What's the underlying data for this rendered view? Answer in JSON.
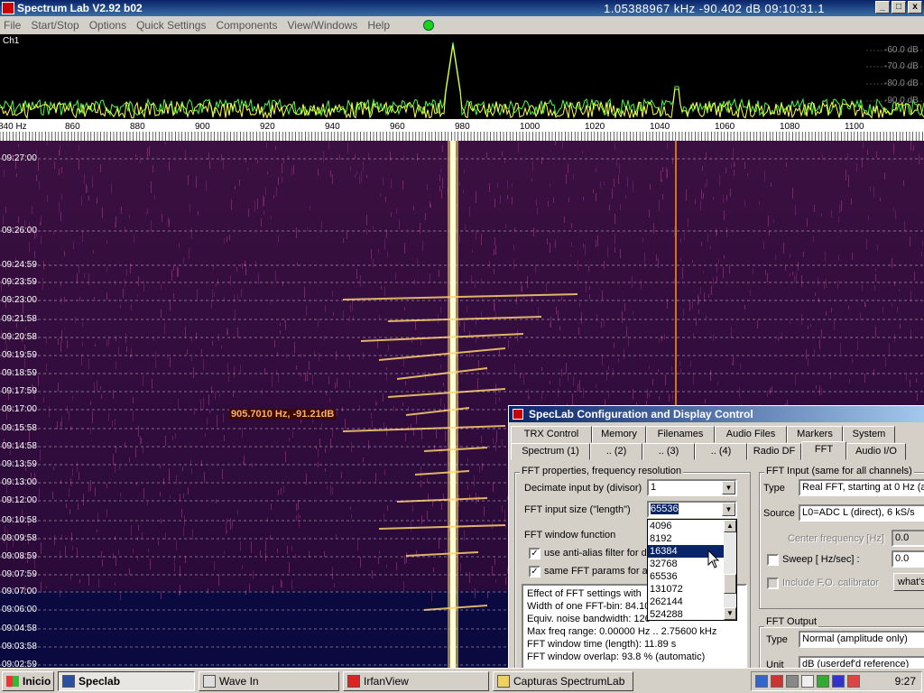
{
  "window": {
    "title": "Spectrum Lab V2.92 b02",
    "readout": "1.05388967 kHz  -90.402 dB  09:10:31.1",
    "min_glyph": "_",
    "max_glyph": "□",
    "close_glyph": "x"
  },
  "menu": [
    "File",
    "Start/Stop",
    "Options",
    "Quick Settings",
    "Components",
    "View/Windows",
    "Help"
  ],
  "spectrum": {
    "channel": "Ch1",
    "db_labels": [
      "-60.0 dB",
      "-70.0 dB",
      "-80.0 dB",
      "-90.0 dB"
    ]
  },
  "freq_axis": {
    "labels": [
      "840 Hz",
      "860",
      "880",
      "900",
      "920",
      "940",
      "960",
      "980",
      "1000",
      "1020",
      "1040",
      "1060",
      "1080",
      "1100"
    ]
  },
  "waterfall": {
    "time_labels": [
      "09:27:00",
      "09:26:00",
      "09:24:59",
      "09:23:59",
      "09:23:00",
      "09:21:58",
      "09:20:58",
      "09:19:59",
      "09:18:59",
      "09:17:59",
      "09:17:00",
      "09:15:58",
      "09:14:58",
      "09:13:59",
      "09:13:00",
      "09:12:00",
      "09:10:58",
      "09:09:58",
      "09:08:59",
      "09:07:59",
      "09:07:00",
      "09:06:00",
      "09:04:58",
      "09:03:58",
      "09:02:59"
    ],
    "cursor_readout": "905.7010 Hz, -91.21dB"
  },
  "dialog": {
    "title": "SpecLab  Configuration and Display Control",
    "tabs_row1": [
      "TRX Control",
      "Memory",
      "Filenames",
      "Audio Files",
      "Markers",
      "System"
    ],
    "tabs_row2": [
      "Spectrum (1)",
      ".. (2)",
      ".. (3)",
      ".. (4)",
      "Radio DF",
      "FFT",
      "Audio I/O"
    ],
    "fft_group": "FFT properties, frequency resolution",
    "decimate_label": "Decimate input by (divisor)",
    "decimate_value": "1",
    "size_label": "FFT input size (\"length\")",
    "size_value": "65536",
    "window_label": "FFT window function",
    "antialias_label": "use anti-alias filter for d",
    "sameparams_label": "same FFT params for al",
    "size_options": [
      "4096",
      "8192",
      "16384",
      "32768",
      "65536",
      "131072",
      "262144",
      "524288"
    ],
    "size_highlight": "16384",
    "info_lines": [
      "Effect of FFT settings with",
      "Width of one FFT-bin: 84.10",
      "Equiv. noise bandwidth: 126",
      "Max freq range: 0.00000 Hz .. 2.75600 kHz",
      "FFT window time (length): 11.89 s",
      "FFT window overlap: 93.8 % (automatic)"
    ],
    "input_group": "FFT Input (same for all channels)",
    "type_label": "Type",
    "type_value": "Real FFT, starting at 0 Hz (a",
    "source_label": "Source",
    "source_value": "L0=ADC L (direct), 6 kS/s",
    "center_label": "Center frequency [Hz]",
    "center_value": "0.0",
    "sweep_label": "Sweep [ Hz/sec] :",
    "sweep_value": "0.0",
    "fo_label": "Include F.O. calibrator",
    "whats_label": "what's",
    "output_group": "FFT Output",
    "out_type_label": "Type",
    "out_type_value": "Normal (amplitude only)",
    "unit_label": "Unit",
    "unit_value": "dB (userdef'd reference)"
  },
  "taskbar": {
    "start": "Inicio",
    "buttons": [
      "Speclab",
      "Wave In",
      "IrfanView",
      "Capturas SpectrumLab"
    ],
    "clock": "9:27"
  }
}
